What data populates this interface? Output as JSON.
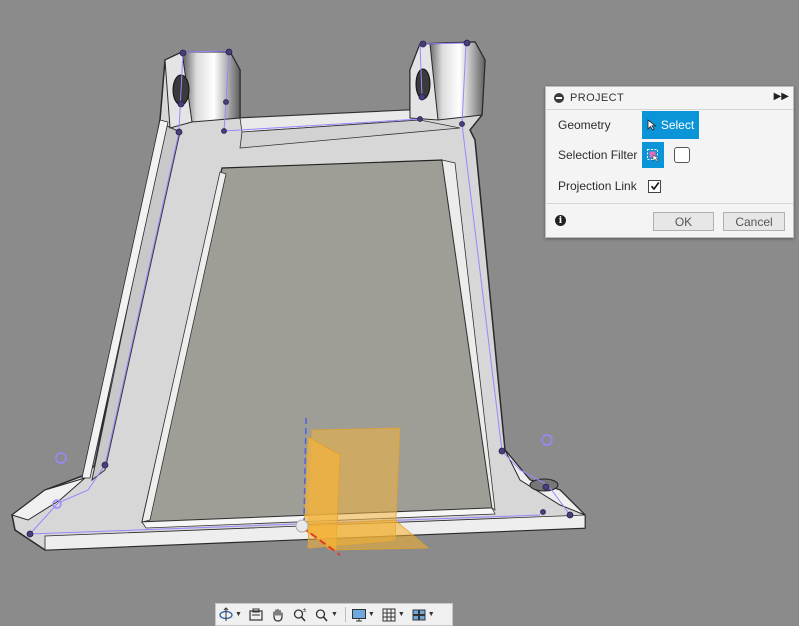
{
  "dialog": {
    "title": "PROJECT",
    "geometry_label": "Geometry",
    "select_button_label": "Select",
    "selection_filter_label": "Selection Filter",
    "projection_link_label": "Projection Link",
    "projection_link_checked": true,
    "ok_label": "OK",
    "cancel_label": "Cancel"
  },
  "toolbar": {
    "items": [
      "orbit-icon",
      "look-at-icon",
      "pan-icon",
      "zoom-icon",
      "zoom-window-icon",
      "display-settings-icon",
      "grid-settings-icon",
      "viewports-icon"
    ]
  },
  "colors": {
    "viewport_bg": "#8b8b8b",
    "accent_blue": "#0b95d8",
    "sketch_purple": "#9a86ff",
    "arrow_pink": "#f06b8a",
    "origin_plane": "#f2b33d"
  }
}
